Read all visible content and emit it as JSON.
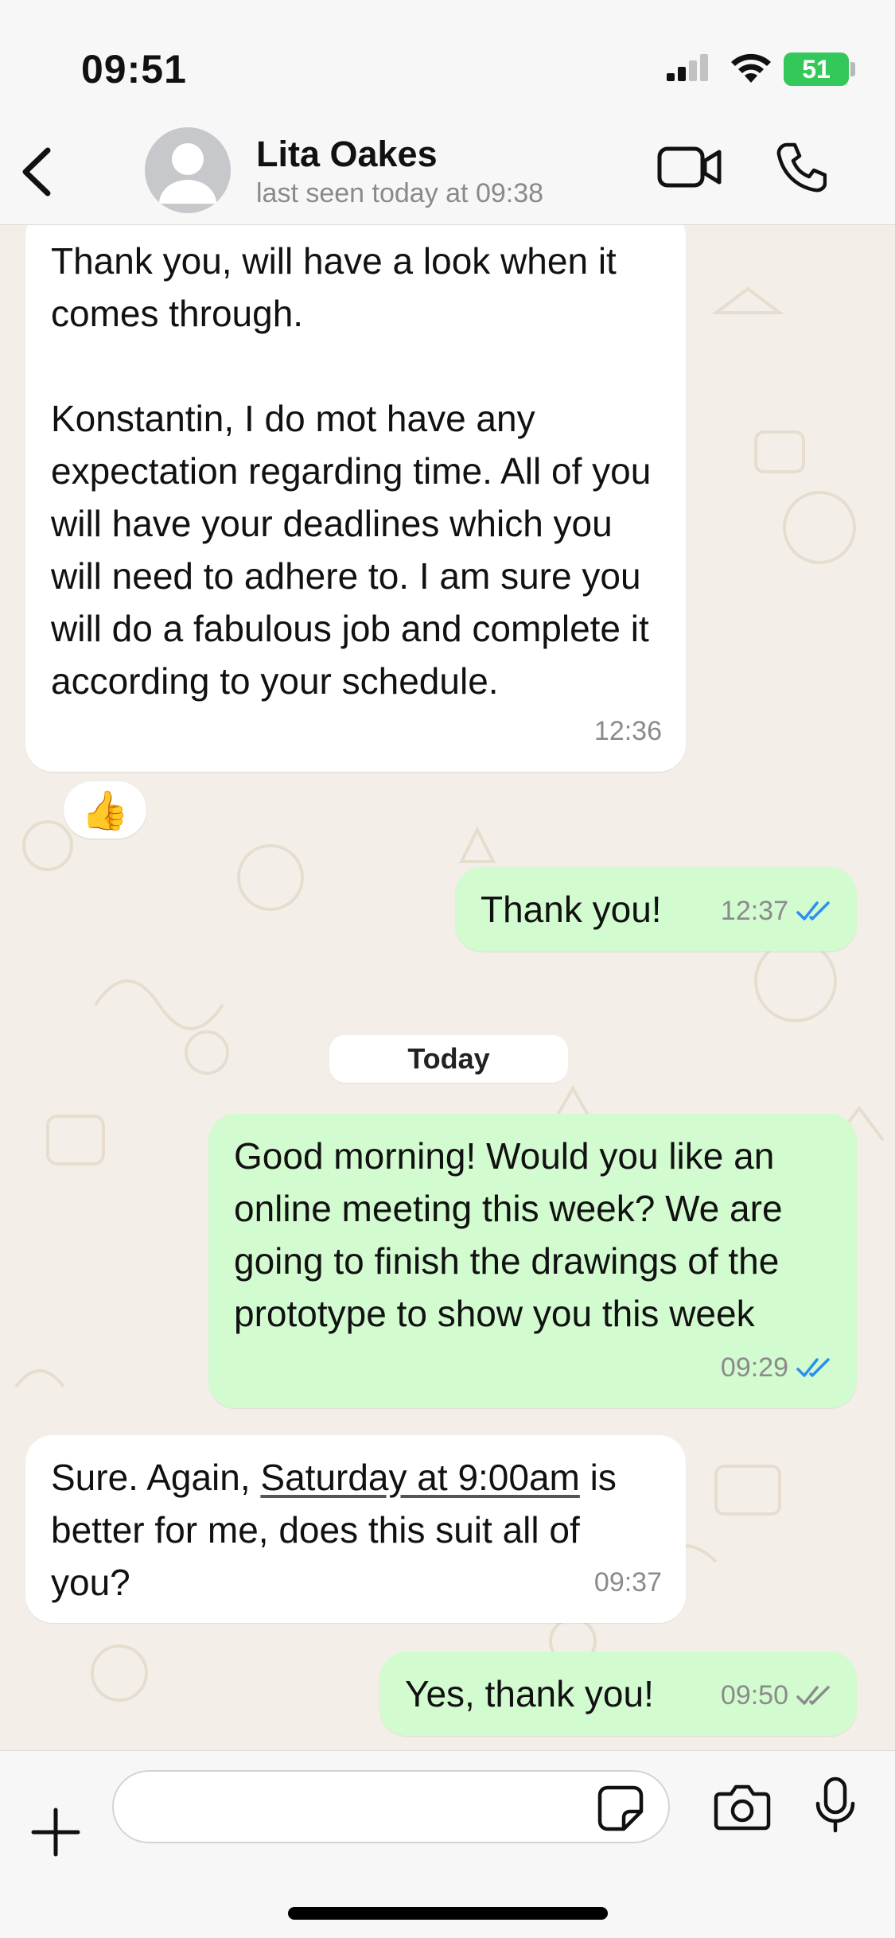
{
  "status_bar": {
    "time": "09:51",
    "battery": "51"
  },
  "header": {
    "contact_name": "Lita Oakes",
    "last_seen": "last seen today at 09:38"
  },
  "messages": [
    {
      "direction": "in",
      "text": "Thank you, will have a look when it comes through.\n\nKonstantin, I do mot have any expectation regarding time. All of you will have your deadlines which you will need to adhere to. I am sure you will do a fabulous job and complete it according to your schedule.",
      "time": "12:36",
      "reaction": "👍"
    },
    {
      "direction": "out",
      "text": "Thank you!",
      "time": "12:37",
      "read": true
    },
    {
      "direction": "out",
      "text": "Good morning! Would you like an online meeting this week? We are going to finish the drawings of the prototype to show you this week",
      "time": "09:29",
      "read": true
    },
    {
      "direction": "in",
      "text_before": "Sure. Again, ",
      "text_link": "Saturday at 9:00am",
      "text_after": " is better for me, does this suit all of you?",
      "time": "09:37"
    },
    {
      "direction": "out",
      "text": "Yes, thank you!",
      "time": "09:50",
      "read": false
    }
  ],
  "date_separator": "Today",
  "composer": {
    "value": "",
    "placeholder": ""
  },
  "colors": {
    "outgoing_bubble": "#d3fbd0",
    "incoming_bubble": "#ffffff",
    "read_ticks": "#2d8ef0",
    "battery": "#34c759"
  },
  "icons": [
    "back-chevron-icon",
    "avatar-placeholder-icon",
    "video-call-icon",
    "phone-call-icon",
    "plus-icon",
    "sticker-icon",
    "camera-icon",
    "microphone-icon",
    "double-check-icon"
  ]
}
